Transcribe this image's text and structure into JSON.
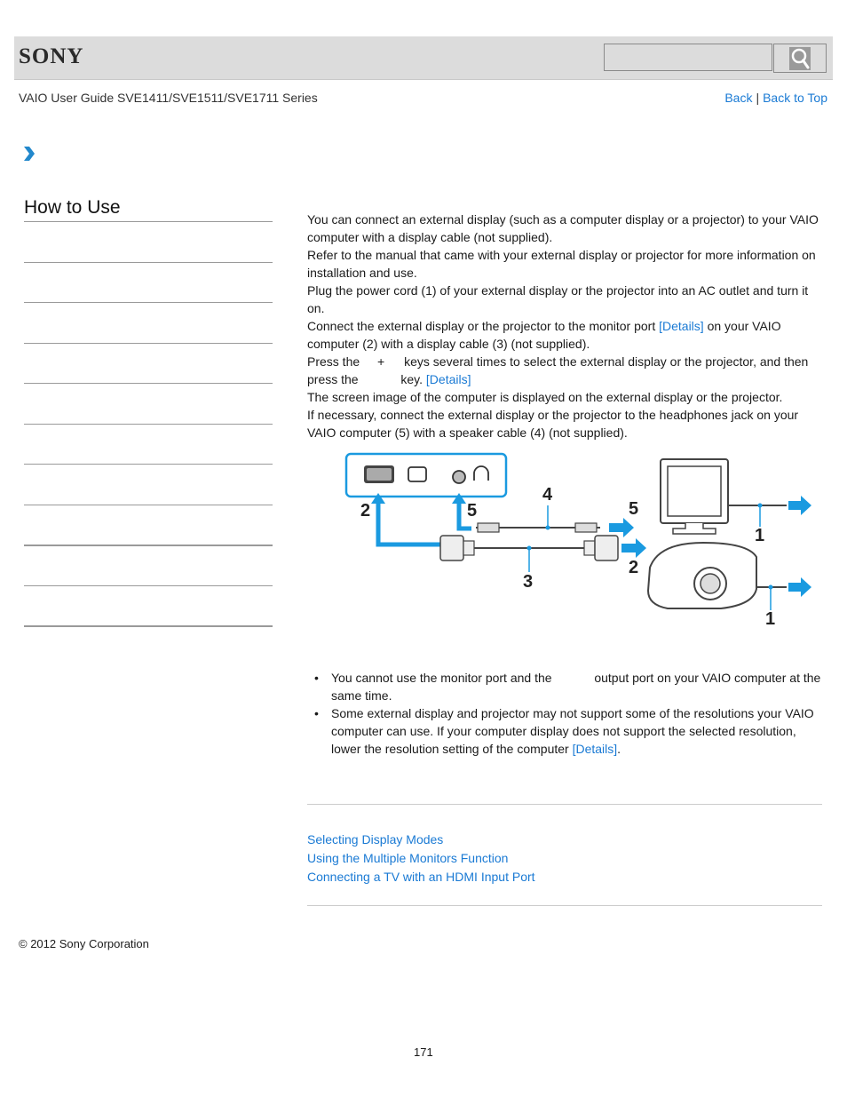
{
  "header": {
    "logo": "SONY",
    "search": {
      "placeholder": "",
      "value": ""
    },
    "search_button_icon": "search-icon"
  },
  "guide_title": "VAIO User Guide SVE1411/SVE1511/SVE1711 Series",
  "top_nav": {
    "back": "Back",
    "separator": "|",
    "back_to_top": "Back to Top"
  },
  "breadcrumb": {
    "icon": "chevron-right-icon"
  },
  "sidebar": {
    "title": "How to Use",
    "items": [
      "",
      "",
      "",
      "",
      "",
      "",
      "",
      "",
      "",
      ""
    ]
  },
  "content": {
    "intro1": "You can connect an external display (such as a computer display or a projector) to your VAIO computer with a display cable (not supplied).",
    "intro2": "Refer to the manual that came with your external display or projector for more information on installation and use.",
    "steps": [
      {
        "text": "Plug the power cord (1) of your external display or the projector into an AC outlet and turn it on."
      },
      {
        "text_before": "Connect the external display or the projector to the monitor port ",
        "link": "[Details]",
        "text_after": " on your VAIO computer (2) with a display cable (3) (not supplied)."
      },
      {
        "text_a": "Press the ",
        "text_plus": "+",
        "text_b": " keys several times to select the external display or the projector, and then press the ",
        "text_c": " key. ",
        "link": "[Details]",
        "text_d": "The screen image of the computer is displayed on the external display or the projector."
      },
      {
        "text": "If necessary, connect the external display or the projector to the headphones jack on your VAIO computer (5) with a speaker cable (4) (not supplied)."
      }
    ],
    "figure": {
      "labels": {
        "monitor_port": "2",
        "headphones_jack": "5",
        "speaker_cable": "4",
        "speaker_to_device": "5",
        "display_cable": "3",
        "display_to_device": "2",
        "power_monitor": "1",
        "power_projector": "1"
      },
      "accent_color": "#1a9ae0"
    },
    "notes": [
      {
        "text_a": "You cannot use the monitor port and the ",
        "text_b": " output port on your VAIO computer at the same time."
      },
      {
        "text": "Some external display and projector may not support some of the resolutions your VAIO computer can use. If your computer display does not support the selected resolution, lower the resolution setting of the computer ",
        "link": "[Details]",
        "text_after": "."
      }
    ]
  },
  "related_links": [
    "Selecting Display Modes",
    "Using the Multiple Monitors Function",
    "Connecting a TV with an HDMI Input Port"
  ],
  "footer": {
    "copyright": "© 2012 Sony Corporation",
    "page_number": "171"
  },
  "colors": {
    "link": "#1a7ad4",
    "header_bg": "#dcdcdc",
    "accent": "#1a9ae0"
  }
}
